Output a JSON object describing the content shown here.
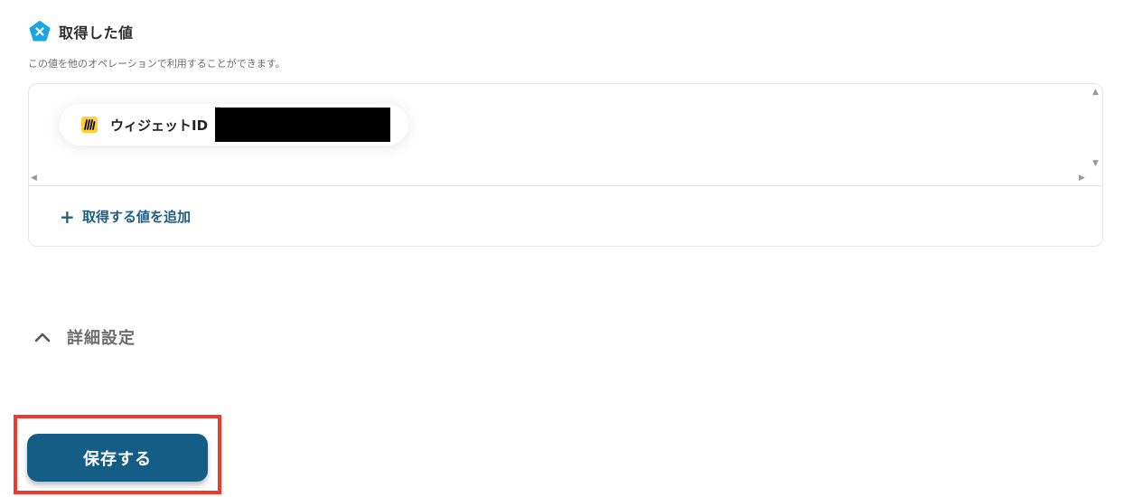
{
  "section": {
    "title": "取得した値",
    "description": "この値を他のオペレーションで利用することができます。",
    "icon": "yoom-x-icon",
    "icon_color": "#1aa6e0"
  },
  "values": [
    {
      "app_icon": "miro-icon",
      "label": "ウィジェットID",
      "value": "[REDACTED]"
    }
  ],
  "add_value_label": "取得する値を追加",
  "advanced": {
    "label": "詳細設定",
    "expanded": true
  },
  "save_button": {
    "label": "保存する",
    "color": "#145d85"
  },
  "highlight_color": "#f0392a"
}
